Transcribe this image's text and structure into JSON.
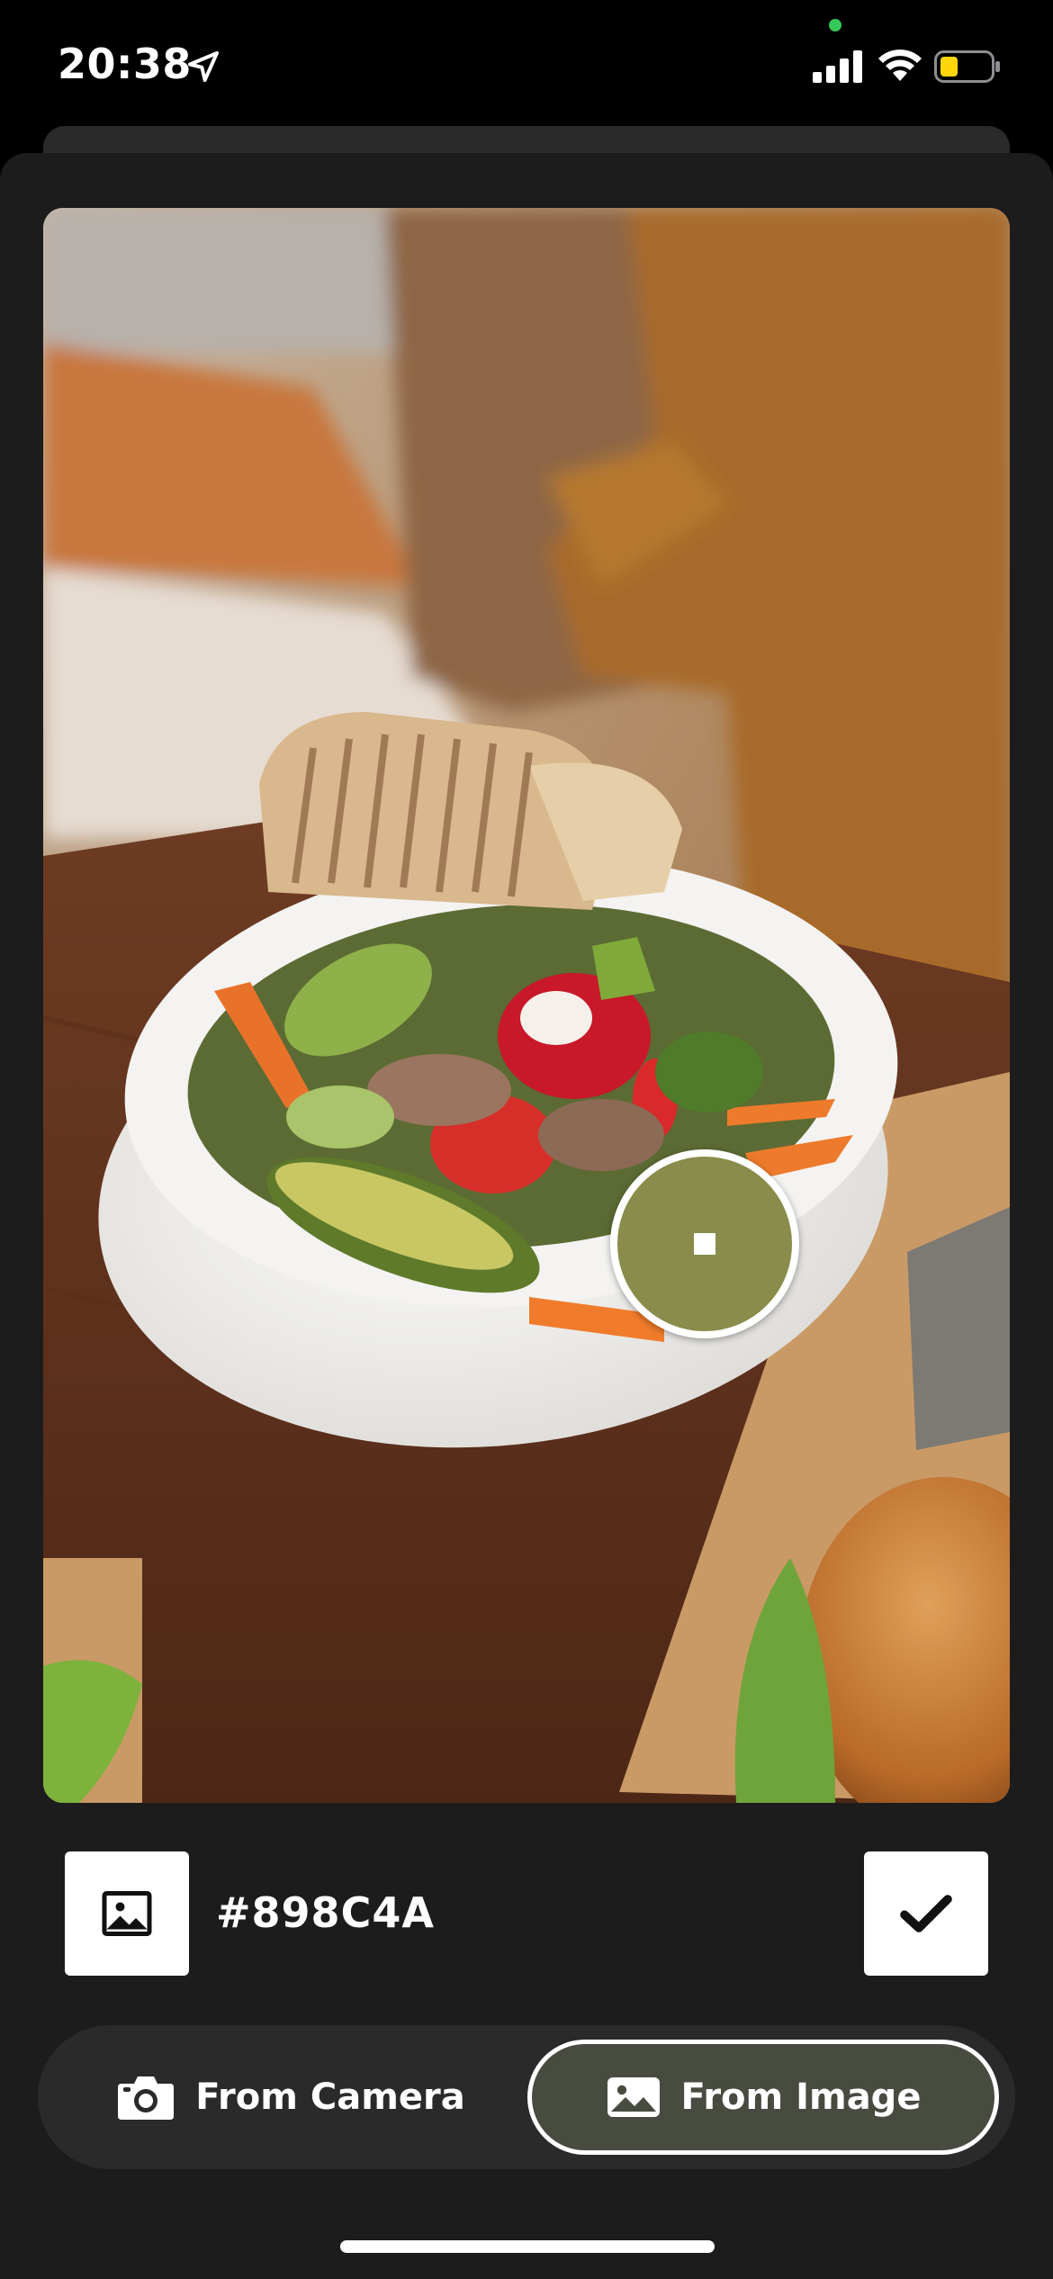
{
  "status_bar": {
    "time": "20:38",
    "icons": [
      "location-arrow-icon",
      "signal-icon",
      "wifi-icon",
      "battery-icon"
    ],
    "battery_color": "#ffd60a",
    "privacy_dot_color": "#34c759"
  },
  "photo": {
    "description_icon": "food-photo"
  },
  "picker": {
    "color": "#898C4A"
  },
  "color_row": {
    "hex": "#898C4A",
    "left_icon": "image-icon",
    "right_icon": "checkmark-icon"
  },
  "source_tabs": {
    "camera_label": "From Camera",
    "image_label": "From Image",
    "selected": "image",
    "selected_bg": "#474b40"
  }
}
